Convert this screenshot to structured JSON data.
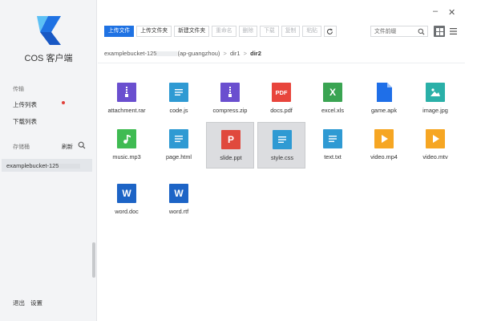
{
  "app": {
    "name": "COS 客户端"
  },
  "sidebar": {
    "transfer_label": "传输",
    "upload_list": "上传列表",
    "download_list": "下载列表",
    "bucket_label": "存储桶",
    "refresh": "刷新",
    "bucket": "examplebucket-125",
    "logout": "退出",
    "settings": "设置"
  },
  "toolbar": {
    "upload_file": "上传文件",
    "upload_folder": "上传文件夹",
    "new_folder": "新建文件夹",
    "rename": "重命名",
    "delete": "删除",
    "download": "下载",
    "copy": "复制",
    "paste": "粘贴"
  },
  "search": {
    "placeholder": "文件前缀"
  },
  "breadcrumb": {
    "bucket": "examplebucket-125",
    "region": "(ap-guangzhou)",
    "dir1": "dir1",
    "dir2": "dir2",
    "separator": ">"
  },
  "colors": {
    "primary": "#1f72e3",
    "zip": "#6a4fcf",
    "doc": "#2f9ad3",
    "pdf": "#e8453c",
    "excel": "#3aa452",
    "apk": "#1f6fe8",
    "image": "#2ab0a8",
    "music": "#3fbb52",
    "video": "#f6a623",
    "word": "#1d64c6",
    "ppt": "#e0493d"
  },
  "files": [
    {
      "name": "attachment.rar",
      "icon": "archive-icon"
    },
    {
      "name": "code.js",
      "icon": "document-icon"
    },
    {
      "name": "compress.zip",
      "icon": "archive-icon"
    },
    {
      "name": "docs.pdf",
      "icon": "pdf-icon",
      "glyph": "PDF"
    },
    {
      "name": "excel.xls",
      "icon": "excel-icon",
      "glyph": "X"
    },
    {
      "name": "game.apk",
      "icon": "file-icon"
    },
    {
      "name": "image.jpg",
      "icon": "image-icon"
    },
    {
      "name": "music.mp3",
      "icon": "music-icon"
    },
    {
      "name": "page.html",
      "icon": "document-icon"
    },
    {
      "name": "slide.ppt",
      "icon": "ppt-icon",
      "glyph": "P",
      "selected": true
    },
    {
      "name": "style.css",
      "icon": "document-icon",
      "selected": true
    },
    {
      "name": "text.txt",
      "icon": "document-icon"
    },
    {
      "name": "video.mp4",
      "icon": "video-icon"
    },
    {
      "name": "video.mtv",
      "icon": "video-icon"
    },
    {
      "name": "word.doc",
      "icon": "word-icon",
      "glyph": "W"
    },
    {
      "name": "word.rtf",
      "icon": "word-icon",
      "glyph": "W"
    }
  ]
}
